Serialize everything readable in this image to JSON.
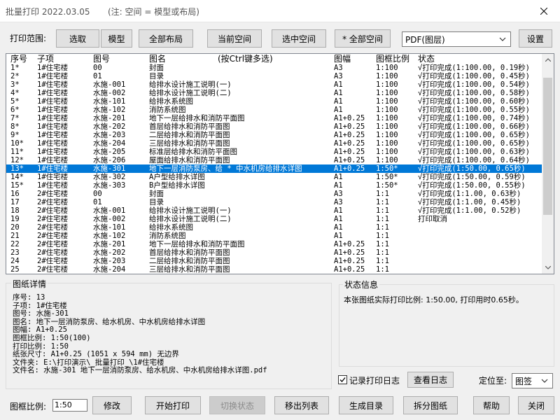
{
  "window": {
    "title": "批量打印 2022.03.05",
    "note": "(注: 空间 = 模型或布局)"
  },
  "toolbar": {
    "range_label": "打印范围:",
    "buttons": [
      "选取",
      "模型",
      "全部布局",
      "当前空间",
      "选中空间",
      "* 全部空间"
    ],
    "format_value": "PDF(图层)",
    "settings_label": "设置"
  },
  "list": {
    "headers": {
      "seq": "序号",
      "sub": "子项",
      "num": "图号",
      "name": "图名",
      "hint": "(按Ctrl键多选)",
      "size": "图幅",
      "scale": "图框比例",
      "status": "状态"
    },
    "selected_index": 12,
    "rows": [
      {
        "seq": "1*",
        "sub": "1#住宅楼",
        "num": "00",
        "name": "封面",
        "size": "A3",
        "scale": "1:100",
        "status": "√打印完成(1:100.00, 0.19秒)"
      },
      {
        "seq": "2*",
        "sub": "1#住宅楼",
        "num": "01",
        "name": "目录",
        "size": "A3",
        "scale": "1:100",
        "status": "√打印完成(1:100.00, 0.45秒)"
      },
      {
        "seq": "3*",
        "sub": "1#住宅楼",
        "num": "水施-001",
        "name": "给排水设计施工说明(一)",
        "size": "A1",
        "scale": "1:100",
        "status": "√打印完成(1:100.00, 0.54秒)"
      },
      {
        "seq": "4*",
        "sub": "1#住宅楼",
        "num": "水施-002",
        "name": "给排水设计施工说明(二)",
        "size": "A1",
        "scale": "1:100",
        "status": "√打印完成(1:100.00, 0.58秒)"
      },
      {
        "seq": "5*",
        "sub": "1#住宅楼",
        "num": "水施-101",
        "name": "给排水系统图",
        "size": "A1",
        "scale": "1:100",
        "status": "√打印完成(1:100.00, 0.60秒)"
      },
      {
        "seq": "6*",
        "sub": "1#住宅楼",
        "num": "水施-102",
        "name": "消防系统图",
        "size": "A1",
        "scale": "1:100",
        "status": "√打印完成(1:100.00, 0.55秒)"
      },
      {
        "seq": "7*",
        "sub": "1#住宅楼",
        "num": "水施-201",
        "name": "地下一层给排水和消防平面图",
        "size": "A1+0.25",
        "scale": "1:100",
        "status": "√打印完成(1:100.00, 0.74秒)"
      },
      {
        "seq": "8*",
        "sub": "1#住宅楼",
        "num": "水施-202",
        "name": "首层给排水和消防平面图",
        "size": "A1+0.25",
        "scale": "1:100",
        "status": "√打印完成(1:100.00, 0.66秒)"
      },
      {
        "seq": "9*",
        "sub": "1#住宅楼",
        "num": "水施-203",
        "name": "二层给排水和消防平面图",
        "size": "A1+0.25",
        "scale": "1:100",
        "status": "√打印完成(1:100.00, 0.65秒)"
      },
      {
        "seq": "10*",
        "sub": "1#住宅楼",
        "num": "水施-204",
        "name": "三层给排水和消防平面图",
        "size": "A1+0.25",
        "scale": "1:100",
        "status": "√打印完成(1:100.00, 0.65秒)"
      },
      {
        "seq": "11*",
        "sub": "1#住宅楼",
        "num": "水施-205",
        "name": "标准层给排水和消防平面图",
        "size": "A1+0.25",
        "scale": "1:100",
        "status": "√打印完成(1:100.00, 0.63秒)"
      },
      {
        "seq": "12*",
        "sub": "1#住宅楼",
        "num": "水施-206",
        "name": "屋面给排水和消防平面图",
        "size": "A1+0.25",
        "scale": "1:100",
        "status": "√打印完成(1:100.00, 0.64秒)"
      },
      {
        "seq": "13*",
        "sub": "1#住宅楼",
        "num": "水施-301",
        "name": "地下一层消防泵房、给 * 中水机房给排水详图",
        "size": "A1+0.25",
        "scale": "1:50*",
        "status": "√打印完成(1:50.00, 0.65秒)"
      },
      {
        "seq": "14*",
        "sub": "1#住宅楼",
        "num": "水施-302",
        "name": "A户型给排水详图",
        "size": "A1",
        "scale": "1:50*",
        "status": "√打印完成(1:50.00, 0.59秒)"
      },
      {
        "seq": "15*",
        "sub": "1#住宅楼",
        "num": "水施-303",
        "name": "B户型给排水详图",
        "size": "A1",
        "scale": "1:50*",
        "status": "√打印完成(1:50.00, 0.55秒)"
      },
      {
        "seq": "16",
        "sub": "2#住宅楼",
        "num": "00",
        "name": "封面",
        "size": "A3",
        "scale": "1:1",
        "status": "√打印完成(1:1.00, 0.63秒)"
      },
      {
        "seq": "17",
        "sub": "2#住宅楼",
        "num": "01",
        "name": "目录",
        "size": "A3",
        "scale": "1:1",
        "status": "√打印完成(1:1.00, 0.45秒)"
      },
      {
        "seq": "18",
        "sub": "2#住宅楼",
        "num": "水施-001",
        "name": "给排水设计施工说明(一)",
        "size": "A1",
        "scale": "1:1",
        "status": "√打印完成(1:1.00, 0.52秒)"
      },
      {
        "seq": "19",
        "sub": "2#住宅楼",
        "num": "水施-002",
        "name": "给排水设计施工说明(二)",
        "size": "A1",
        "scale": "1:1",
        "status": "打印取消"
      },
      {
        "seq": "20",
        "sub": "2#住宅楼",
        "num": "水施-101",
        "name": "给排水系统图",
        "size": "A1",
        "scale": "1:1",
        "status": ""
      },
      {
        "seq": "21",
        "sub": "2#住宅楼",
        "num": "水施-102",
        "name": "消防系统图",
        "size": "A1",
        "scale": "1:1",
        "status": ""
      },
      {
        "seq": "22",
        "sub": "2#住宅楼",
        "num": "水施-201",
        "name": "地下一层给排水和消防平面图",
        "size": "A1+0.25",
        "scale": "1:1",
        "status": ""
      },
      {
        "seq": "23",
        "sub": "2#住宅楼",
        "num": "水施-202",
        "name": "首层给排水和消防平面图",
        "size": "A1+0.25",
        "scale": "1:1",
        "status": ""
      },
      {
        "seq": "24",
        "sub": "2#住宅楼",
        "num": "水施-203",
        "name": "二层给排水和消防平面图",
        "size": "A1+0.25",
        "scale": "1:1",
        "status": ""
      },
      {
        "seq": "25",
        "sub": "2#住宅楼",
        "num": "水施-204",
        "name": "三层给排水和消防平面图",
        "size": "A1+0.25",
        "scale": "1:1",
        "status": ""
      }
    ]
  },
  "details": {
    "title": "图纸详情",
    "lines": [
      "序号: 13",
      "子项: 1#住宅楼",
      "图号: 水施-301",
      "图名: 地下一层消防泵房、给水机房、中水机房给排水详图",
      "图幅: A1+0.25",
      "图框比例: 1:50(100)",
      "打印比例: 1:50",
      "纸张尺寸: A1+0.25 (1051 x 594 mm) 无边界",
      "文件夹: E:\\打印演示\\_批量打印_\\1#住宅楼",
      "文件名: 水施-301 地下一层消防泵房、给水机房、中水机房给排水详图.pdf"
    ]
  },
  "status_info": {
    "title": "状态信息",
    "message": "本张图纸实际打印比例: 1:50.00, 打印用时0.65秒。"
  },
  "options": {
    "log_checked": true,
    "log_label": "记录打印日志",
    "view_log_label": "查看日志",
    "locate_label": "定位至:",
    "locate_value": "图签"
  },
  "bottom": {
    "frame_scale_label": "图框比例:",
    "frame_scale_value": "1:50",
    "buttons": [
      "修改",
      "开始打印",
      "切换状态",
      "移出列表",
      "生成目录",
      "拆分图纸",
      "帮助",
      "关闭"
    ]
  },
  "colors": {
    "selection": "#0078d7",
    "window_bg": "#f0f0f0",
    "button_bg": "#e1e1e1"
  },
  "icons": {
    "close": "close-icon",
    "dropdown": "chevron-down-icon",
    "scroll_up": "scroll-up-arrow-icon",
    "scroll_down": "scroll-down-arrow-icon",
    "check": "checkmark-icon"
  }
}
